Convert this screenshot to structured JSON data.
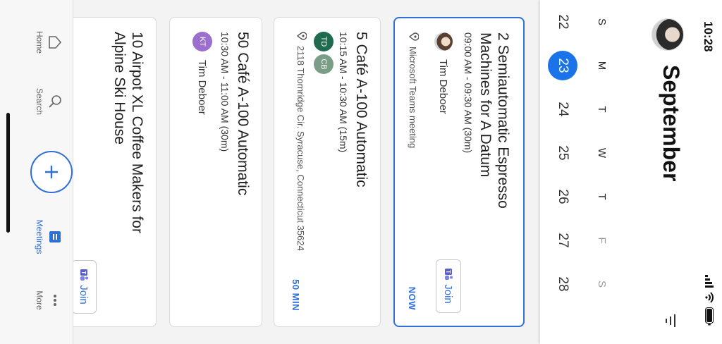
{
  "status": {
    "time": "10:28"
  },
  "header": {
    "month": "September",
    "weekdays": [
      "S",
      "M",
      "T",
      "W",
      "T",
      "F",
      "S"
    ],
    "dates": [
      "22",
      "23",
      "24",
      "25",
      "26",
      "27",
      "28"
    ],
    "selected_index": 1
  },
  "meetings": [
    {
      "title": "2 Semiautomatic Espresso Machines for A Datum",
      "time": "09:00 AM - 09:30 AM (30m)",
      "organizer": "Tim Deboer",
      "location": "Microsoft Teams meeting",
      "join_label": "Join",
      "badge": "NOW"
    },
    {
      "title": "5 Café A-100 Automatic",
      "time": "10:15 AM - 10:30 AM (15m)",
      "attendees": [
        {
          "initials": "TD",
          "color": "#1f6b4f"
        },
        {
          "initials": "CB",
          "color": "#7a9d86"
        }
      ],
      "location": "2118 Thornridge Cir. Syracuse, Connecticut 35624",
      "badge": "50 MIN"
    },
    {
      "title": "50 Café A-100 Automatic",
      "time": "10:30 AM - 11:00 AM (30m)",
      "organizer_initials": "KT",
      "organizer_color": "#9b6fcf",
      "organizer": "Tim Deboer"
    },
    {
      "title": "10 Airpot XL Coffee Makers for Alpine Ski House",
      "join_label": "Join"
    }
  ],
  "nav": {
    "home": "Home",
    "search": "Search",
    "meetings": "Meetings",
    "more": "More"
  },
  "colors": {
    "accent": "#2f6fd6",
    "selected_date": "#1a73e8"
  }
}
